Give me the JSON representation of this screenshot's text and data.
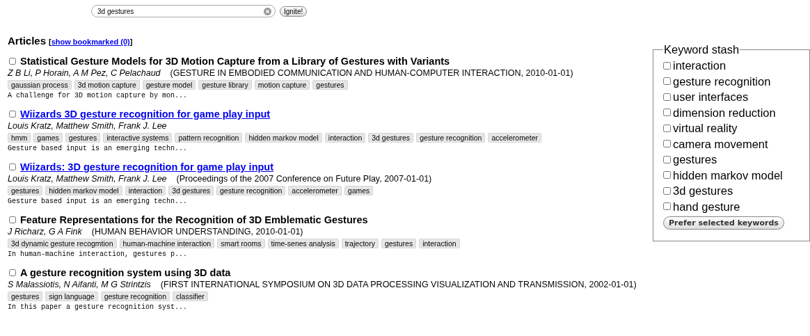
{
  "search": {
    "value": "3d gestures",
    "button": "Ignite!"
  },
  "heading": {
    "title": "Articles",
    "bracket_open": "[",
    "link": "show bookmarked (0)",
    "bracket_close": "]"
  },
  "articles": [
    {
      "checked": false,
      "kind": "plain",
      "title": "Statistical Gesture Models for 3D Motion Capture from a Library of Gestures with Variants",
      "authors": "Z B Li, P Horain, A M Pez, C Pelachaud",
      "venue": "(GESTURE IN EMBODIED COMMUNICATION AND HUMAN-COMPUTER INTERACTION, 2010-01-01)",
      "tags": [
        "gaussian process",
        "3d motion capture",
        "gesture model",
        "gesture library",
        "motion capture",
        "gestures"
      ],
      "snippet": "A challenge for 3D motion capture by mon..."
    },
    {
      "checked": false,
      "kind": "link",
      "title": "Wiizards 3D gesture recognition for game play input",
      "authors": "Louis Kratz, Matthew Smith, Frank J. Lee",
      "tags": [
        "hmm",
        "games",
        "gestures",
        "interactive systems",
        "pattern recognition",
        "hidden markov model",
        "interaction",
        "3d gestures",
        "gesture recognition",
        "accelerometer"
      ],
      "snippet": "Gesture based input is an emerging techn..."
    },
    {
      "checked": false,
      "kind": "link",
      "title": "Wiizards: 3D gesture recognition for game play input",
      "authors": "Louis Kratz, Matthew Smith, Frank J. Lee",
      "venue": "(Proceedings of the 2007 Conference on Future Play, 2007-01-01)",
      "tags": [
        "gestures",
        "hidden markov model",
        "interaction",
        "3d gestures",
        "gesture recognition",
        "accelerometer",
        "games"
      ],
      "snippet": "Gesture based input is an emerging techn..."
    },
    {
      "checked": false,
      "kind": "plain",
      "title": "Feature Representations for the Recognition of 3D Emblematic Gestures",
      "authors": "J Richarz, G A Fink",
      "venue": "(HUMAN BEHAVIOR UNDERSTANDING, 2010-01-01)",
      "tags": [
        "3d dynamic gesture recogmtion",
        "human-machine interaction",
        "smart rooms",
        "time-senes analysis",
        "trajectory",
        "gestures",
        "interaction"
      ],
      "snippet": "In human-machine interaction, gestures p..."
    },
    {
      "checked": false,
      "kind": "plain",
      "title": "A gesture recognition system using 3D data",
      "authors": "S Malassiotis, N Aifanti, M G Strintzis",
      "venue": "(FIRST INTERNATIONAL SYMPOSIUM ON 3D DATA PROCESSING VISUALIZATION AND TRANSMISSION, 2002-01-01)",
      "tags": [
        "gestures",
        "sign language",
        "gesture recognition",
        "classifier"
      ],
      "snippet": "In this paper a gesture recognition syst..."
    }
  ],
  "keyword_stash": {
    "legend": "Keyword stash",
    "keywords": [
      {
        "label": "interaction",
        "checked": false
      },
      {
        "label": "gesture recognition",
        "checked": false
      },
      {
        "label": "user interfaces",
        "checked": false
      },
      {
        "label": "dimension reduction",
        "checked": false
      },
      {
        "label": "virtual reality",
        "checked": false
      },
      {
        "label": "camera movement",
        "checked": false
      },
      {
        "label": "gestures",
        "checked": false
      },
      {
        "label": "hidden markov model",
        "checked": false
      },
      {
        "label": "3d gestures",
        "checked": false
      },
      {
        "label": "hand gesture",
        "checked": false
      }
    ],
    "button": "Prefer selected keywords"
  }
}
